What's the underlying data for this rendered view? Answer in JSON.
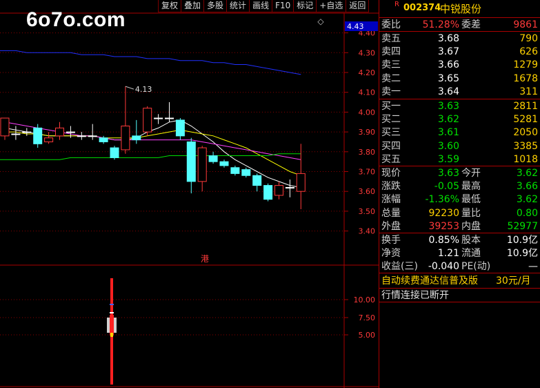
{
  "logo": "6o7o.com",
  "toolbar": [
    "复权",
    "叠加",
    "多股",
    "统计",
    "画线",
    "F10",
    "标记",
    "+自选",
    "返回"
  ],
  "stock": {
    "flag": "R",
    "code": "002374",
    "name": "中锐股份"
  },
  "colors": {
    "up": "#ff3a3a",
    "down": "#54ffff",
    "ma5": "#ffffff",
    "ma10": "#ffff00",
    "ma20": "#ff40ff",
    "ma60": "#00e000",
    "ma_long": "#2030ff",
    "grid": "#8b0000"
  },
  "price_axis": {
    "current_tag": "4.43",
    "ticks": [
      "4.40",
      "4.30",
      "4.20",
      "4.10",
      "4.00",
      "3.90",
      "3.80",
      "3.70",
      "3.60",
      "3.50",
      "3.40"
    ]
  },
  "annotation": "4.13",
  "hk_badge": "港",
  "indicator_axis": [
    "10.00",
    "7.50",
    "5.00"
  ],
  "candles": [
    {
      "o": 3.88,
      "c": 3.97,
      "h": 3.97,
      "l": 3.86
    },
    {
      "o": 3.89,
      "c": 3.89,
      "h": 3.93,
      "l": 3.86
    },
    {
      "o": 3.9,
      "c": 3.9,
      "h": 3.92,
      "l": 3.88
    },
    {
      "o": 3.92,
      "c": 3.84,
      "h": 3.94,
      "l": 3.82
    },
    {
      "o": 3.85,
      "c": 3.87,
      "h": 3.9,
      "l": 3.84
    },
    {
      "o": 3.88,
      "c": 3.92,
      "h": 3.95,
      "l": 3.86
    },
    {
      "o": 3.9,
      "c": 3.9,
      "h": 3.93,
      "l": 3.87
    },
    {
      "o": 3.88,
      "c": 3.88,
      "h": 3.9,
      "l": 3.86
    },
    {
      "o": 3.88,
      "c": 3.88,
      "h": 3.94,
      "l": 3.86
    },
    {
      "o": 3.87,
      "c": 3.85,
      "h": 3.88,
      "l": 3.84
    },
    {
      "o": 3.82,
      "c": 3.77,
      "h": 3.83,
      "l": 3.76
    },
    {
      "o": 3.81,
      "c": 3.93,
      "h": 4.13,
      "l": 3.79
    },
    {
      "o": 3.88,
      "c": 3.86,
      "h": 3.96,
      "l": 3.84
    },
    {
      "o": 3.9,
      "c": 4.02,
      "h": 4.03,
      "l": 3.88
    },
    {
      "o": 3.97,
      "c": 3.97,
      "h": 3.99,
      "l": 3.94
    },
    {
      "o": 3.97,
      "c": 3.97,
      "h": 4.05,
      "l": 3.95
    },
    {
      "o": 3.96,
      "c": 3.88,
      "h": 3.97,
      "l": 3.86
    },
    {
      "o": 3.85,
      "c": 3.65,
      "h": 3.87,
      "l": 3.59
    },
    {
      "o": 3.65,
      "c": 3.82,
      "h": 3.83,
      "l": 3.6
    },
    {
      "o": 3.78,
      "c": 3.75,
      "h": 3.8,
      "l": 3.74
    },
    {
      "o": 3.75,
      "c": 3.73,
      "h": 3.76,
      "l": 3.72
    },
    {
      "o": 3.72,
      "c": 3.69,
      "h": 3.73,
      "l": 3.68
    },
    {
      "o": 3.71,
      "c": 3.68,
      "h": 3.72,
      "l": 3.67
    },
    {
      "o": 3.68,
      "c": 3.63,
      "h": 3.69,
      "l": 3.6
    },
    {
      "o": 3.63,
      "c": 3.56,
      "h": 3.64,
      "l": 3.55
    },
    {
      "o": 3.58,
      "c": 3.63,
      "h": 3.65,
      "l": 3.56
    },
    {
      "o": 3.62,
      "c": 3.62,
      "h": 3.66,
      "l": 3.57
    },
    {
      "o": 3.6,
      "c": 3.69,
      "h": 3.84,
      "l": 3.51
    }
  ],
  "mas": {
    "ma5": [
      3.92,
      3.91,
      3.9,
      3.89,
      3.88,
      3.88,
      3.88,
      3.88,
      3.88,
      3.87,
      3.86,
      3.86,
      3.87,
      3.9,
      3.92,
      3.95,
      3.96,
      3.93,
      3.89,
      3.85,
      3.8,
      3.76,
      3.73,
      3.7,
      3.67,
      3.65,
      3.63,
      3.62
    ],
    "ma10": [
      3.9,
      3.9,
      3.89,
      3.89,
      3.88,
      3.88,
      3.88,
      3.88,
      3.88,
      3.87,
      3.87,
      3.87,
      3.87,
      3.88,
      3.89,
      3.9,
      3.91,
      3.9,
      3.89,
      3.88,
      3.86,
      3.84,
      3.82,
      3.79,
      3.76,
      3.73,
      3.7,
      3.68
    ],
    "ma20": [
      3.95,
      3.94,
      3.93,
      3.92,
      3.91,
      3.9,
      3.89,
      3.88,
      3.88,
      3.87,
      3.86,
      3.86,
      3.86,
      3.86,
      3.86,
      3.86,
      3.86,
      3.86,
      3.85,
      3.84,
      3.83,
      3.82,
      3.81,
      3.8,
      3.79,
      3.78,
      3.77,
      3.76
    ],
    "ma60": [
      3.76,
      3.76,
      3.76,
      3.76,
      3.76,
      3.76,
      3.77,
      3.77,
      3.77,
      3.77,
      3.77,
      3.77,
      3.77,
      3.77,
      3.77,
      3.78,
      3.78,
      3.78,
      3.78,
      3.78,
      3.78,
      3.78,
      3.78,
      3.78,
      3.78,
      3.79,
      3.79,
      3.79
    ],
    "ma_long": [
      4.31,
      4.31,
      4.3,
      4.3,
      4.3,
      4.3,
      4.3,
      4.29,
      4.29,
      4.29,
      4.28,
      4.28,
      4.28,
      4.27,
      4.27,
      4.27,
      4.26,
      4.26,
      4.26,
      4.25,
      4.25,
      4.24,
      4.24,
      4.23,
      4.22,
      4.21,
      4.2,
      4.19
    ]
  },
  "quote": {
    "weibi": {
      "label": "委比",
      "value": "51.28%",
      "label2": "委差",
      "value2": "9861"
    },
    "asks": [
      {
        "label": "卖五",
        "price": "3.68",
        "vol": "790"
      },
      {
        "label": "卖四",
        "price": "3.67",
        "vol": "626"
      },
      {
        "label": "卖三",
        "price": "3.66",
        "vol": "1279"
      },
      {
        "label": "卖二",
        "price": "3.65",
        "vol": "1678"
      },
      {
        "label": "卖一",
        "price": "3.64",
        "vol": "311"
      }
    ],
    "bids": [
      {
        "label": "买一",
        "price": "3.63",
        "vol": "2811"
      },
      {
        "label": "买二",
        "price": "3.62",
        "vol": "5281"
      },
      {
        "label": "买三",
        "price": "3.61",
        "vol": "2050"
      },
      {
        "label": "买四",
        "price": "3.60",
        "vol": "3385"
      },
      {
        "label": "买五",
        "price": "3.59",
        "vol": "1018"
      }
    ],
    "stats": [
      {
        "l1": "现价",
        "v1": "3.63",
        "c1": "green",
        "l2": "今开",
        "v2": "3.62",
        "c2": "green"
      },
      {
        "l1": "涨跌",
        "v1": "-0.05",
        "c1": "green",
        "l2": "最高",
        "v2": "3.66",
        "c2": "green"
      },
      {
        "l1": "涨幅",
        "v1": "-1.36%",
        "c1": "green",
        "l2": "最低",
        "v2": "3.62",
        "c2": "green"
      },
      {
        "l1": "总量",
        "v1": "92230",
        "c1": "yel",
        "l2": "量比",
        "v2": "0.80",
        "c2": "green"
      },
      {
        "l1": "外盘",
        "v1": "39253",
        "c1": "red",
        "l2": "内盘",
        "v2": "52977",
        "c2": "green"
      }
    ],
    "fin": [
      {
        "l1": "换手",
        "v1": "0.85%",
        "l2": "股本",
        "v2": "10.9亿"
      },
      {
        "l1": "净资",
        "v1": "1.21",
        "l2": "流通",
        "v2": "10.9亿"
      },
      {
        "l1": "收益(三)",
        "v1": "-0.040",
        "l2": "PE(动)",
        "v2": "—"
      }
    ],
    "promo": "自动续费通达信普及版",
    "promo_price": "30元/月",
    "status": "行情连接已断开"
  }
}
